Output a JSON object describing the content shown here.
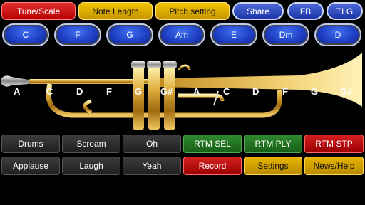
{
  "top_bar": {
    "tune_scale": "Tune/Scale",
    "note_length": "Note Length",
    "pitch_setting": "Pitch setting",
    "share": "Share",
    "fb": "FB",
    "tlg": "TLG"
  },
  "chords": [
    "C",
    "F",
    "G",
    "Am",
    "E",
    "Dm",
    "D"
  ],
  "notes": [
    "A",
    "C",
    "D",
    "F",
    "G",
    "G#",
    "A",
    "C",
    "D",
    "F",
    "G",
    "G#"
  ],
  "controls": {
    "drums": "Drums",
    "scream": "Scream",
    "oh": "Oh",
    "rtm_sel": "RTM SEL",
    "rtm_ply": "RTM PLY",
    "rtm_stp": "RTM STP",
    "applause": "Applause",
    "laugh": "Laugh",
    "yeah": "Yeah",
    "record": "Record",
    "settings": "Settings",
    "news_help": "News/Help"
  },
  "colors": {
    "accent_red": "#c80000",
    "accent_gold": "#d8a800",
    "accent_blue": "#2a46c0",
    "accent_green": "#237523",
    "background": "#000000"
  },
  "icons": {
    "trumpet": "trumpet-image"
  }
}
